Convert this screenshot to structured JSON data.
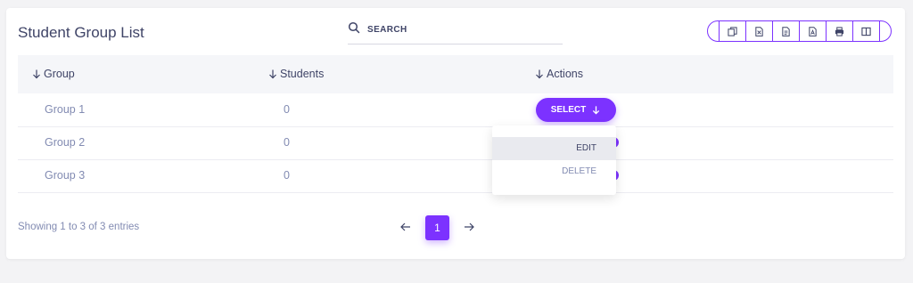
{
  "header": {
    "title": "Student Group List",
    "search_placeholder": "SEARCH",
    "export_buttons": [
      {
        "name": "copy-icon"
      },
      {
        "name": "excel-icon"
      },
      {
        "name": "csv-icon"
      },
      {
        "name": "pdf-icon"
      },
      {
        "name": "print-icon"
      },
      {
        "name": "columns-icon"
      }
    ]
  },
  "table": {
    "columns": [
      "Group",
      "Students",
      "Actions"
    ],
    "rows": [
      {
        "group": "Group 1",
        "students": "0"
      },
      {
        "group": "Group 2",
        "students": "0"
      },
      {
        "group": "Group 3",
        "students": "0"
      }
    ],
    "select_label": "SELECT",
    "dropdown": [
      "EDIT",
      "DELETE"
    ]
  },
  "footer": {
    "info": "Showing 1 to 3 of 3 entries",
    "current_page": "1"
  },
  "colors": {
    "accent": "#7c32ff",
    "text": "#3f4467",
    "muted": "#828bb2"
  }
}
